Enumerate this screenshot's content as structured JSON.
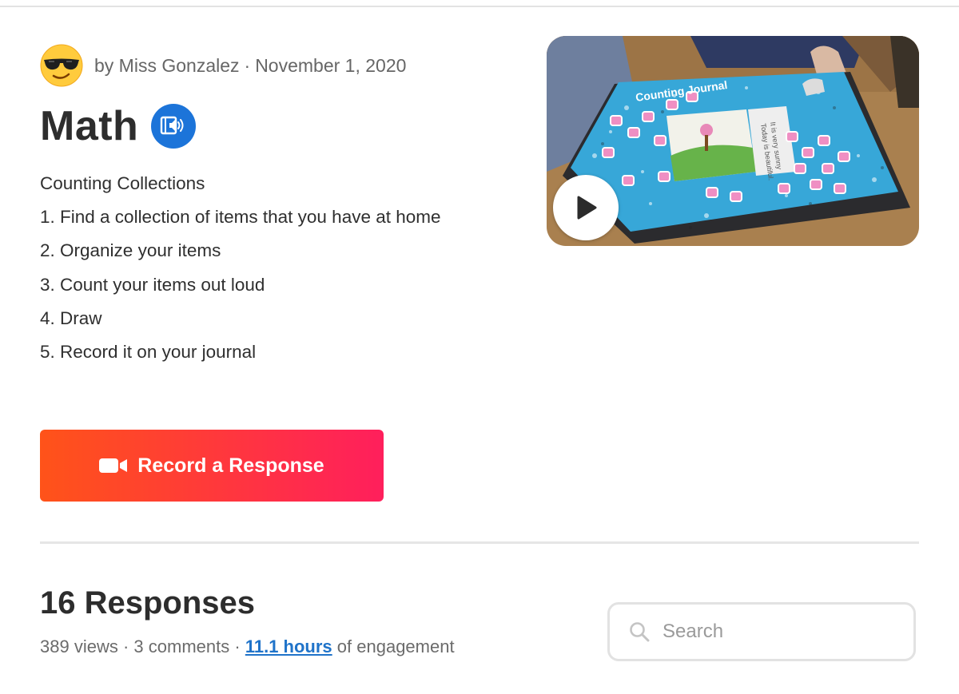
{
  "post": {
    "author": "by Miss Gonzalez",
    "separator": "·",
    "date": "November 1, 2020",
    "title": "Math",
    "description_lines": [
      "Counting Collections",
      "1. Find a collection of items that you have at home",
      "2. Organize your items",
      "3. Count your items out loud",
      "4. Draw",
      "5. Record it on your journal"
    ],
    "avatar_icon": "sunglasses-emoji-icon",
    "audio_icon": "immersive-reader-icon"
  },
  "video": {
    "play_icon": "play-icon",
    "journal_title": "Counting Journal",
    "journal_text": [
      "Today is beautiful.",
      "It is very sunny"
    ]
  },
  "actions": {
    "record_label": "Record a Response",
    "record_icon": "video-camera-icon"
  },
  "responses": {
    "title": "16 Responses",
    "views": "389 views",
    "separator": "·",
    "comments": "3 comments",
    "engagement_value": "11.1 hours",
    "engagement_suffix": "of engagement"
  },
  "search": {
    "placeholder": "Search",
    "icon": "search-icon"
  },
  "colors": {
    "accent_blue": "#1c74d9",
    "record_gradient_start": "#ff5319",
    "record_gradient_end": "#ff1f5c",
    "link": "#1f73c9"
  }
}
